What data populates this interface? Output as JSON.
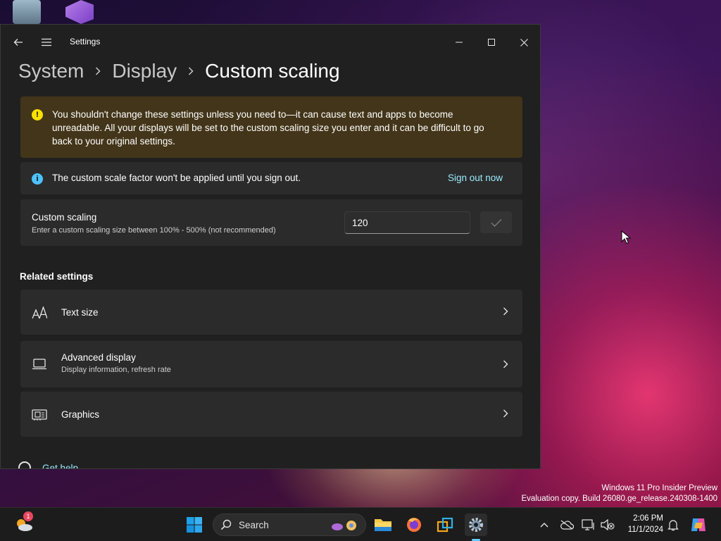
{
  "window": {
    "title": "Settings",
    "breadcrumb": [
      "System",
      "Display",
      "Custom scaling"
    ]
  },
  "warning": {
    "text": "You shouldn't change these settings unless you need to—it can cause text and apps to become unreadable. All your displays will be set to the custom scaling size you enter and it can be difficult to go back to your original settings."
  },
  "info": {
    "text": "The custom scale factor won't be applied until you sign out.",
    "link": "Sign out now"
  },
  "custom_scaling": {
    "title": "Custom scaling",
    "description": "Enter a custom scaling size between 100% - 500% (not recommended)",
    "value": "120"
  },
  "related": {
    "heading": "Related settings",
    "items": [
      {
        "title": "Text size",
        "subtitle": "",
        "icon": "text-size-icon"
      },
      {
        "title": "Advanced display",
        "subtitle": "Display information, refresh rate",
        "icon": "laptop-icon"
      },
      {
        "title": "Graphics",
        "subtitle": "",
        "icon": "graphics-card-icon"
      }
    ]
  },
  "help": {
    "label": "Get help"
  },
  "watermark": {
    "line1": "Windows 11 Pro Insider Preview",
    "line2": "Evaluation copy. Build 26080.ge_release.240308-1400"
  },
  "taskbar": {
    "search_label": "Search",
    "weather_badge": "1",
    "time": "2:06 PM",
    "date": "11/1/2024"
  },
  "colors": {
    "accent": "#60cdff",
    "warning_bg": "#433519",
    "link": "#99ebff"
  }
}
